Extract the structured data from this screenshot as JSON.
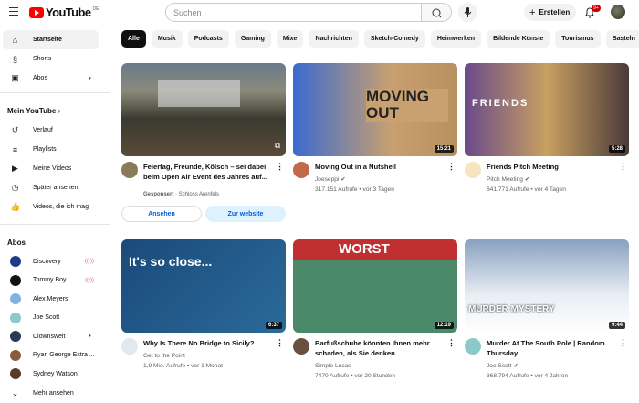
{
  "header": {
    "logo": "YouTube",
    "country": "DE",
    "search_placeholder": "Suchen",
    "create_label": "Erstellen",
    "notifications": "9+"
  },
  "sidebar": {
    "main": [
      {
        "label": "Startseite",
        "icon": "home-icon"
      },
      {
        "label": "Shorts",
        "icon": "shorts-icon"
      },
      {
        "label": "Abos",
        "icon": "subscriptions-icon"
      }
    ],
    "you_heading": "Mein YouTube",
    "you": [
      {
        "label": "Verlauf",
        "icon": "history-icon"
      },
      {
        "label": "Playlists",
        "icon": "playlists-icon"
      },
      {
        "label": "Meine Videos",
        "icon": "your-videos-icon"
      },
      {
        "label": "Später ansehen",
        "icon": "watch-later-icon"
      },
      {
        "label": "Videos, die ich mag",
        "icon": "like-icon"
      }
    ],
    "subs_heading": "Abos",
    "subs": [
      {
        "label": "Discovery",
        "color": "#1e3a8a"
      },
      {
        "label": "Tommy Boy",
        "color": "#111"
      },
      {
        "label": "Alex Meyers",
        "color": "#7fb3e0"
      },
      {
        "label": "Joe Scott",
        "color": "#8ec9c9"
      },
      {
        "label": "Clownswelt",
        "color": "#2a3a55"
      },
      {
        "label": "Ryan George Extra ...",
        "color": "#8a5a3a"
      },
      {
        "label": "Sydney Watson",
        "color": "#5a3a2a"
      }
    ],
    "more": "Mehr ansehen"
  },
  "chips": [
    "Alle",
    "Musik",
    "Podcasts",
    "Gaming",
    "Mixe",
    "Nachrichten",
    "Sketch-Comedy",
    "Heimwerken",
    "Bildende Künste",
    "Tourismus",
    "Basteln"
  ],
  "ad": {
    "title": "Feiertag, Freunde, Kölsch – sei dabei beim Open Air Event des Jahres auf...",
    "sponsored": "Gesponsert",
    "advertiser": "Schloss Arenfels",
    "btn1": "Ansehen",
    "btn2": "Zur website"
  },
  "videos": [
    {
      "title": "Moving Out in a Nutshell",
      "channel": "Joeseppi",
      "stats": "317.151 Aufrufe • vor 3 Tagen",
      "duration": "15:21",
      "overlay": "MOVING OUT"
    },
    {
      "title": "Friends Pitch Meeting",
      "channel": "Pitch Meeting",
      "stats": "641.771 Aufrufe • vor 4 Tagen",
      "duration": "5:28",
      "overlay": "FRIENDS"
    },
    {
      "title": "Why Is There No Bridge to Sicily?",
      "channel": "Get to the Point",
      "stats": "1,9 Mio. Aufrufe • vor 1 Monat",
      "duration": "6:37",
      "overlay": "It's so close..."
    },
    {
      "title": "Barfußschuhe könnten Ihnen mehr schaden, als Sie denken",
      "channel": "Simple Lucas",
      "stats": "7470 Aufrufe • vor 20 Stunden",
      "duration": "12:19",
      "overlay": "WORST"
    },
    {
      "title": "Murder At The South Pole | Random Thursday",
      "channel": "Joe Scott",
      "stats": "368.794 Aufrufe • vor 4 Jahren",
      "duration": "9:44",
      "overlay": "MURDER MYSTERY"
    }
  ]
}
